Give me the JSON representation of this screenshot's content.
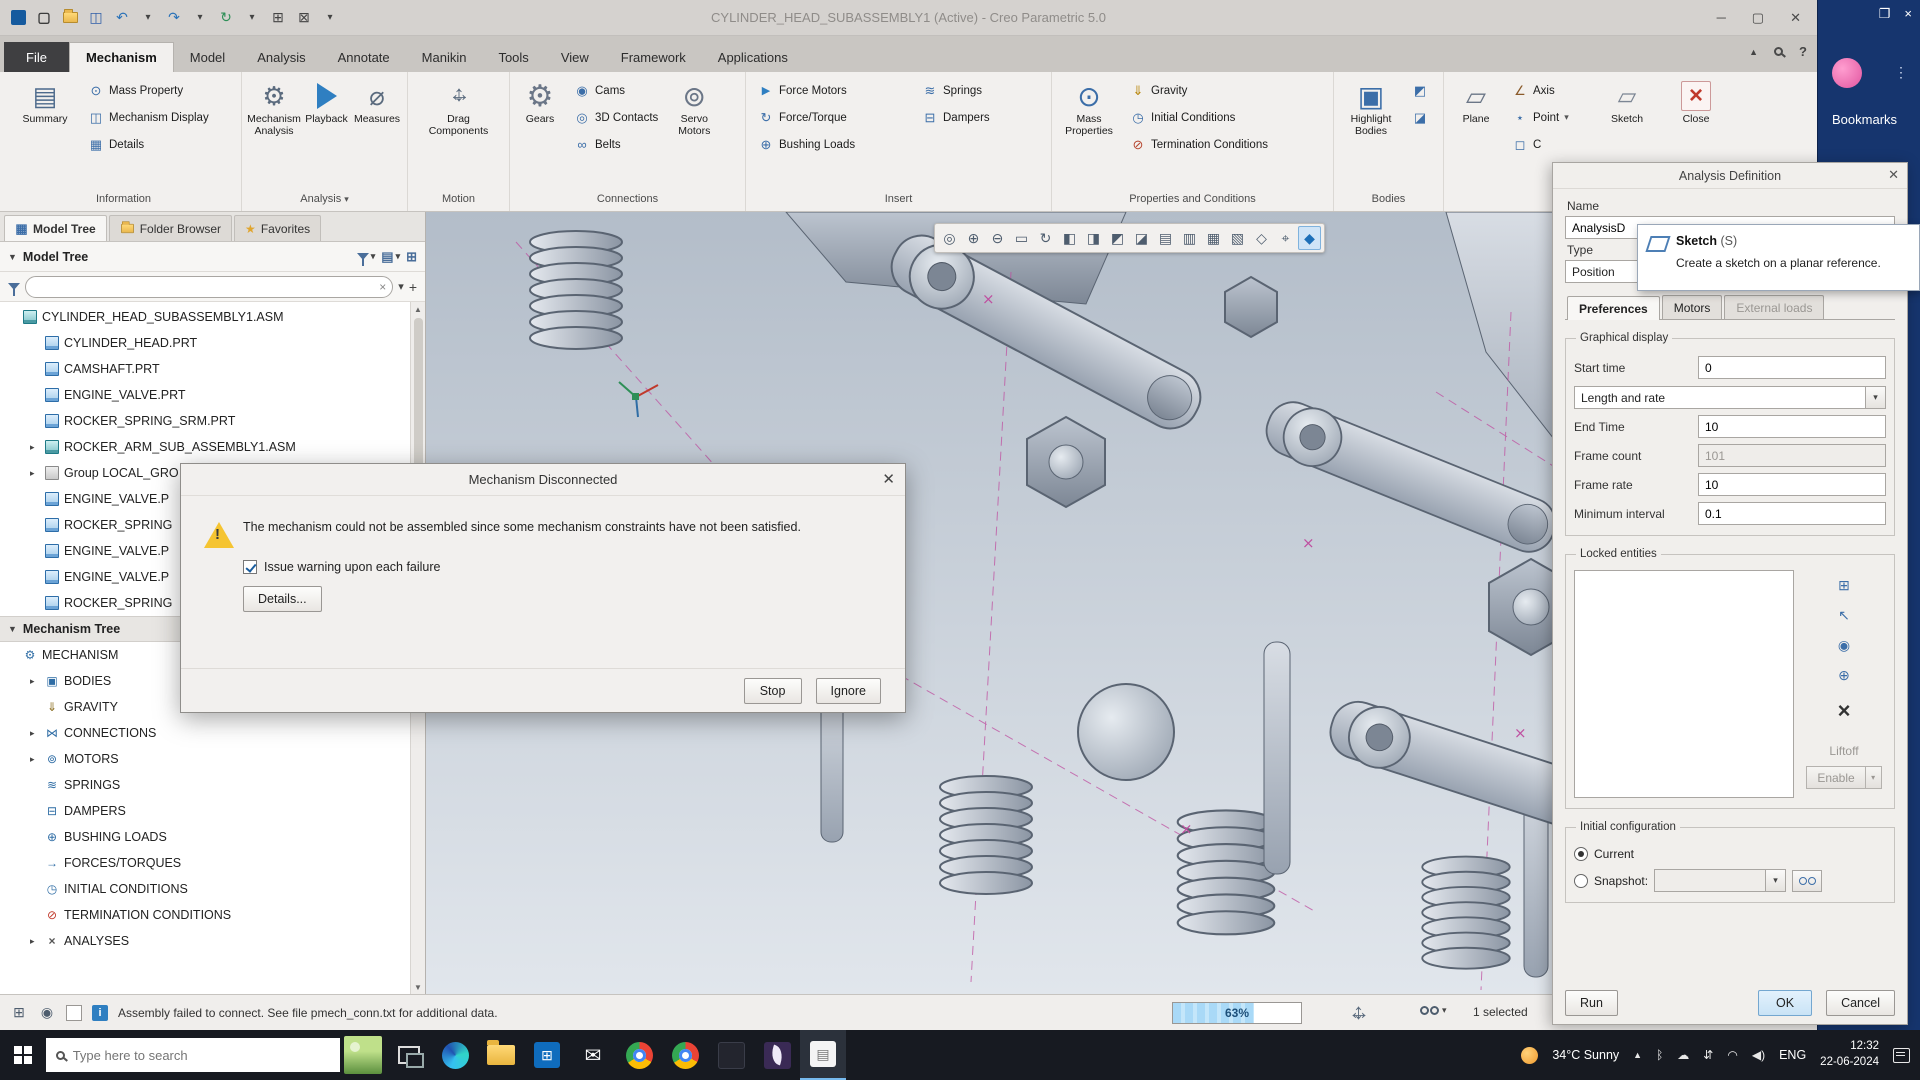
{
  "titlebar": {
    "title": "CYLINDER_HEAD_SUBASSEMBLY1 (Active) - Creo Parametric 5.0"
  },
  "menu_tabs": [
    {
      "label": "File",
      "cls": "t-file"
    },
    {
      "label": "Mechanism",
      "cls": "t-active"
    },
    {
      "label": "Model",
      "cls": ""
    },
    {
      "label": "Analysis",
      "cls": ""
    },
    {
      "label": "Annotate",
      "cls": ""
    },
    {
      "label": "Manikin",
      "cls": ""
    },
    {
      "label": "Tools",
      "cls": ""
    },
    {
      "label": "View",
      "cls": ""
    },
    {
      "label": "Framework",
      "cls": ""
    },
    {
      "label": "Applications",
      "cls": ""
    }
  ],
  "ribbon": {
    "information": {
      "label": "Information",
      "summary": "Summary",
      "mass_property": "Mass Property",
      "mechanism_display": "Mechanism Display",
      "details": "Details"
    },
    "analysis": {
      "label": "Analysis",
      "mechanism_analysis": "Mechanism Analysis",
      "playback": "Playback",
      "measures": "Measures"
    },
    "motion": {
      "label": "Motion",
      "drag_components": "Drag Components"
    },
    "connections": {
      "label": "Connections",
      "gears": "Gears",
      "cams": "Cams",
      "contacts_3d": "3D Contacts",
      "belts": "Belts",
      "servo_motors": "Servo Motors"
    },
    "insert": {
      "label": "Insert",
      "force_motors": "Force Motors",
      "force_torque": "Force/Torque",
      "bushing_loads": "Bushing Loads",
      "springs": "Springs",
      "dampers": "Dampers"
    },
    "properties": {
      "label": "Properties and Conditions",
      "mass_properties": "Mass Properties",
      "gravity": "Gravity",
      "initial_conditions": "Initial Conditions",
      "termination_conditions": "Termination Conditions"
    },
    "bodies": {
      "label": "Bodies",
      "highlight_bodies": "Highlight Bodies"
    },
    "datum": {
      "plane": "Plane",
      "axis": "Axis",
      "point": "Point",
      "truncated": "C"
    },
    "sketch": "Sketch",
    "close": "Close"
  },
  "tree_panel": {
    "tabs": {
      "model_tree": "Model Tree",
      "folder_browser": "Folder Browser",
      "favorites": "Favorites"
    },
    "section_title": "Model Tree",
    "model_items": [
      {
        "label": "CYLINDER_HEAD_SUBASSEMBLY1.ASM",
        "icon": "ti-asm",
        "arr": "",
        "ind": "ind0"
      },
      {
        "label": "CYLINDER_HEAD.PRT",
        "icon": "ti-part",
        "arr": "",
        "ind": "ind1"
      },
      {
        "label": "CAMSHAFT.PRT",
        "icon": "ti-part",
        "arr": "",
        "ind": "ind1"
      },
      {
        "label": "ENGINE_VALVE.PRT",
        "icon": "ti-part",
        "arr": "",
        "ind": "ind1"
      },
      {
        "label": "ROCKER_SPRING_SRM.PRT",
        "icon": "ti-part",
        "arr": "",
        "ind": "ind1"
      },
      {
        "label": "ROCKER_ARM_SUB_ASSEMBLY1.ASM",
        "icon": "ti-asm",
        "arr": "arr-r",
        "ind": "ind1"
      },
      {
        "label": "Group LOCAL_GRO",
        "icon": "ti-group",
        "arr": "arr-r",
        "ind": "ind1"
      },
      {
        "label": "ENGINE_VALVE.P",
        "icon": "ti-part",
        "arr": "",
        "ind": "ind1"
      },
      {
        "label": "ROCKER_SPRING",
        "icon": "ti-part",
        "arr": "",
        "ind": "ind1"
      },
      {
        "label": "ENGINE_VALVE.P",
        "icon": "ti-part",
        "arr": "",
        "ind": "ind1"
      },
      {
        "label": "ENGINE_VALVE.P",
        "icon": "ti-part",
        "arr": "",
        "ind": "ind1"
      },
      {
        "label": "ROCKER_SPRING",
        "icon": "ti-part",
        "arr": "",
        "ind": "ind1"
      }
    ],
    "mech_header": "Mechanism Tree",
    "mech_items": [
      {
        "label": "MECHANISM",
        "icon": "mi-mech",
        "arr": "",
        "ind": "ind0"
      },
      {
        "label": "BODIES",
        "icon": "mi-bodies",
        "arr": "arr-r",
        "ind": "ind1"
      },
      {
        "label": "GRAVITY",
        "icon": "mi-grav",
        "arr": "",
        "ind": "ind1"
      },
      {
        "label": "CONNECTIONS",
        "icon": "mi-conn",
        "arr": "arr-r",
        "ind": "ind1"
      },
      {
        "label": "MOTORS",
        "icon": "mi-motor",
        "arr": "arr-r",
        "ind": "ind1"
      },
      {
        "label": "SPRINGS",
        "icon": "mi-spring",
        "arr": "",
        "ind": "ind1"
      },
      {
        "label": "DAMPERS",
        "icon": "mi-damper",
        "arr": "",
        "ind": "ind1"
      },
      {
        "label": "BUSHING LOADS",
        "icon": "mi-bush",
        "arr": "",
        "ind": "ind1"
      },
      {
        "label": "FORCES/TORQUES",
        "icon": "mi-force",
        "arr": "",
        "ind": "ind1"
      },
      {
        "label": "INITIAL CONDITIONS",
        "icon": "mi-init",
        "arr": "",
        "ind": "ind1"
      },
      {
        "label": "TERMINATION CONDITIONS",
        "icon": "mi-term",
        "arr": "",
        "ind": "ind1"
      },
      {
        "label": "ANALYSES",
        "icon": "mi-ana",
        "arr": "arr-r",
        "ind": "ind1"
      }
    ]
  },
  "graphics_toolbar": [
    {
      "name": "zoom-region-icon",
      "glyph": "◎",
      "cls": ""
    },
    {
      "name": "zoom-in-icon",
      "glyph": "⊕",
      "cls": ""
    },
    {
      "name": "zoom-out-icon",
      "glyph": "⊖",
      "cls": ""
    },
    {
      "name": "refit-icon",
      "glyph": "▭",
      "cls": ""
    },
    {
      "name": "repaint-icon",
      "glyph": "↻",
      "cls": ""
    },
    {
      "name": "shading-with-edges-icon",
      "glyph": "◧",
      "cls": ""
    },
    {
      "name": "shading-icon",
      "glyph": "◨",
      "cls": ""
    },
    {
      "name": "no-hidden-icon",
      "glyph": "◩",
      "cls": ""
    },
    {
      "name": "hidden-line-icon",
      "glyph": "◪",
      "cls": ""
    },
    {
      "name": "wireframe-icon",
      "glyph": "▤",
      "cls": ""
    },
    {
      "name": "datum-plane-display-icon",
      "glyph": "▥",
      "cls": ""
    },
    {
      "name": "datum-axis-display-icon",
      "glyph": "▦",
      "cls": ""
    },
    {
      "name": "datum-point-display-icon",
      "glyph": "▧",
      "cls": ""
    },
    {
      "name": "csys-display-icon",
      "glyph": "◇",
      "cls": ""
    },
    {
      "name": "spin-center-icon",
      "glyph": "⌖",
      "cls": ""
    },
    {
      "name": "view-orientation-icon",
      "glyph": "◆",
      "cls": "tb-active"
    }
  ],
  "dialog": {
    "title": "Mechanism Disconnected",
    "message": "The mechanism could not be assembled since some mechanism constraints have not been satisfied.",
    "checkbox_label": "Issue warning upon each failure",
    "details_button": "Details...",
    "stop_button": "Stop",
    "ignore_button": "Ignore"
  },
  "panel": {
    "title": "Analysis Definition",
    "name_label": "Name",
    "name_value": "AnalysisD",
    "type_label": "Type",
    "type_value": "Position",
    "tabs": [
      {
        "label": "Preferences",
        "cls": "pt-active"
      },
      {
        "label": "Motors",
        "cls": ""
      },
      {
        "label": "External loads",
        "cls": "pt-dis"
      }
    ],
    "graphical": {
      "legend": "Graphical display",
      "start_time_label": "Start time",
      "start_time": "0",
      "mode": "Length and rate",
      "end_time_label": "End Time",
      "end_time": "10",
      "frame_count_label": "Frame count",
      "frame_count": "101",
      "frame_rate_label": "Frame rate",
      "frame_rate": "10",
      "min_interval_label": "Minimum interval",
      "min_interval": "0.1"
    },
    "locked": {
      "legend": "Locked entities",
      "liftoff": "Liftoff",
      "enable": "Enable"
    },
    "initial": {
      "legend": "Initial configuration",
      "current": "Current",
      "snapshot": "Snapshot:"
    },
    "run": "Run",
    "ok": "OK",
    "cancel": "Cancel"
  },
  "tooltip": {
    "title": "Sketch",
    "shortcut": "(S)",
    "description": "Create a sketch on a planar reference."
  },
  "status": {
    "message": "Assembly failed to connect. See file pmech_conn.txt for additional data.",
    "progress": "63%",
    "selected": "1 selected"
  },
  "taskbar": {
    "search_placeholder": "Type here to search",
    "weather": "34°C Sunny",
    "language": "ENG",
    "time": "12:32",
    "date": "22-06-2024"
  },
  "browser": {
    "bookmarks": "Bookmarks"
  }
}
